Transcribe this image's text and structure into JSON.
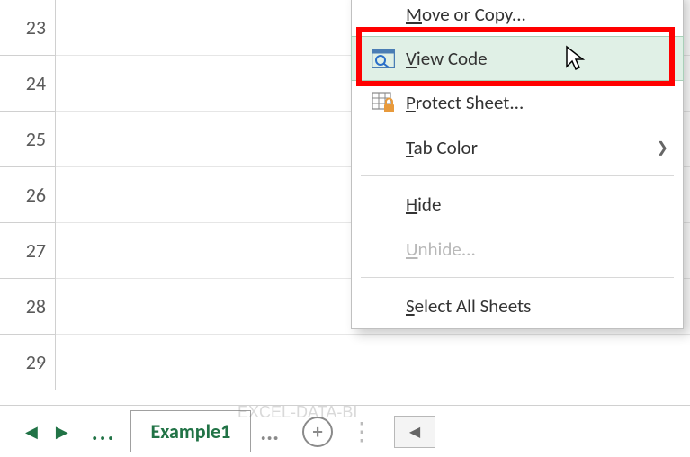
{
  "rows": [
    23,
    24,
    25,
    26,
    27,
    28,
    29
  ],
  "sheet_bar": {
    "active_tab": "Example1",
    "ellipsis": "..."
  },
  "menu": {
    "move_or_copy": "ove or Copy...",
    "view_code": "iew Code",
    "protect_sheet": "rotect Sheet...",
    "tab_color": "ab Color",
    "hide": "ide",
    "unhide": "nhide...",
    "select_all": "elect All Sheets",
    "mn": {
      "m": "M",
      "v": "V",
      "p": "P",
      "t": "T",
      "h": "H",
      "u": "U",
      "s": "S"
    }
  },
  "watermark": "EXCEL-DATA-BI"
}
